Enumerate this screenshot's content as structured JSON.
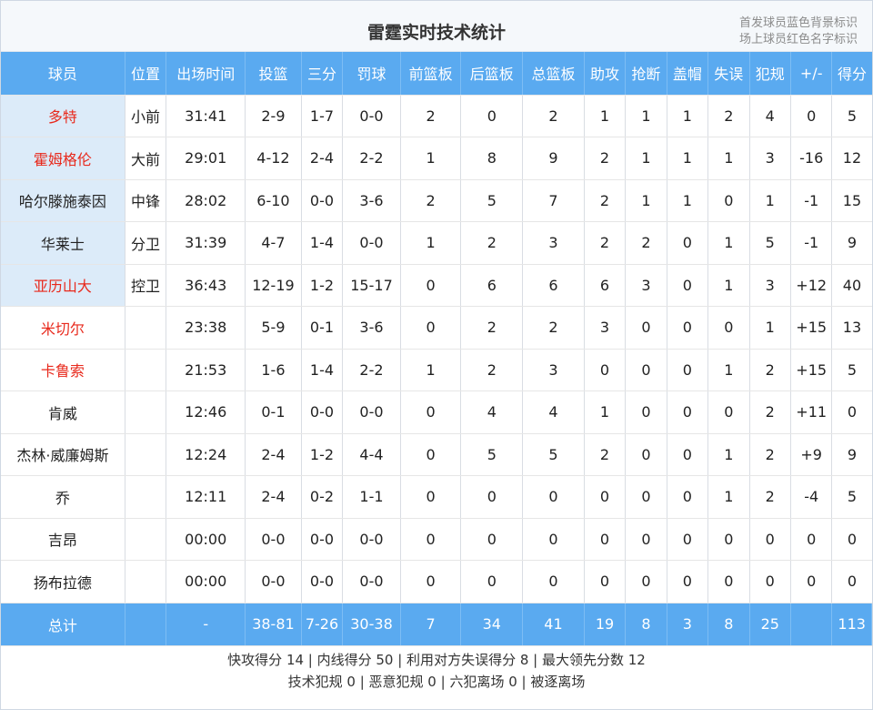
{
  "title": "雷霆实时技术统计",
  "legend": {
    "line1": "首发球员蓝色背景标识",
    "line2": "场上球员红色名字标识"
  },
  "colors": {
    "header_bg": "#5aaaf0",
    "starter_bg": "#dcebf9",
    "on_court_name": "#e8291c"
  },
  "columns": [
    "球员",
    "位置",
    "出场时间",
    "投篮",
    "三分",
    "罚球",
    "前篮板",
    "后篮板",
    "总篮板",
    "助攻",
    "抢断",
    "盖帽",
    "失误",
    "犯规",
    "+/-",
    "得分"
  ],
  "players": [
    {
      "name": "多特",
      "pos": "小前",
      "min": "31:41",
      "fg": "2-9",
      "tp": "1-7",
      "ft": "0-0",
      "oreb": "2",
      "dreb": "0",
      "reb": "2",
      "ast": "1",
      "stl": "1",
      "blk": "1",
      "tov": "2",
      "pf": "4",
      "pm": "0",
      "pts": "5",
      "starter": true,
      "on_court": true
    },
    {
      "name": "霍姆格伦",
      "pos": "大前",
      "min": "29:01",
      "fg": "4-12",
      "tp": "2-4",
      "ft": "2-2",
      "oreb": "1",
      "dreb": "8",
      "reb": "9",
      "ast": "2",
      "stl": "1",
      "blk": "1",
      "tov": "1",
      "pf": "3",
      "pm": "-16",
      "pts": "12",
      "starter": true,
      "on_court": true
    },
    {
      "name": "哈尔滕施泰因",
      "pos": "中锋",
      "min": "28:02",
      "fg": "6-10",
      "tp": "0-0",
      "ft": "3-6",
      "oreb": "2",
      "dreb": "5",
      "reb": "7",
      "ast": "2",
      "stl": "1",
      "blk": "1",
      "tov": "0",
      "pf": "1",
      "pm": "-1",
      "pts": "15",
      "starter": true,
      "on_court": false
    },
    {
      "name": "华莱士",
      "pos": "分卫",
      "min": "31:39",
      "fg": "4-7",
      "tp": "1-4",
      "ft": "0-0",
      "oreb": "1",
      "dreb": "2",
      "reb": "3",
      "ast": "2",
      "stl": "2",
      "blk": "0",
      "tov": "1",
      "pf": "5",
      "pm": "-1",
      "pts": "9",
      "starter": true,
      "on_court": false
    },
    {
      "name": "亚历山大",
      "pos": "控卫",
      "min": "36:43",
      "fg": "12-19",
      "tp": "1-2",
      "ft": "15-17",
      "oreb": "0",
      "dreb": "6",
      "reb": "6",
      "ast": "6",
      "stl": "3",
      "blk": "0",
      "tov": "1",
      "pf": "3",
      "pm": "+12",
      "pts": "40",
      "starter": true,
      "on_court": true
    },
    {
      "name": "米切尔",
      "pos": "",
      "min": "23:38",
      "fg": "5-9",
      "tp": "0-1",
      "ft": "3-6",
      "oreb": "0",
      "dreb": "2",
      "reb": "2",
      "ast": "3",
      "stl": "0",
      "blk": "0",
      "tov": "0",
      "pf": "1",
      "pm": "+15",
      "pts": "13",
      "starter": false,
      "on_court": true
    },
    {
      "name": "卡鲁索",
      "pos": "",
      "min": "21:53",
      "fg": "1-6",
      "tp": "1-4",
      "ft": "2-2",
      "oreb": "1",
      "dreb": "2",
      "reb": "3",
      "ast": "0",
      "stl": "0",
      "blk": "0",
      "tov": "1",
      "pf": "2",
      "pm": "+15",
      "pts": "5",
      "starter": false,
      "on_court": true
    },
    {
      "name": "肯威",
      "pos": "",
      "min": "12:46",
      "fg": "0-1",
      "tp": "0-0",
      "ft": "0-0",
      "oreb": "0",
      "dreb": "4",
      "reb": "4",
      "ast": "1",
      "stl": "0",
      "blk": "0",
      "tov": "0",
      "pf": "2",
      "pm": "+11",
      "pts": "0",
      "starter": false,
      "on_court": false
    },
    {
      "name": "杰林·威廉姆斯",
      "pos": "",
      "min": "12:24",
      "fg": "2-4",
      "tp": "1-2",
      "ft": "4-4",
      "oreb": "0",
      "dreb": "5",
      "reb": "5",
      "ast": "2",
      "stl": "0",
      "blk": "0",
      "tov": "1",
      "pf": "2",
      "pm": "+9",
      "pts": "9",
      "starter": false,
      "on_court": false
    },
    {
      "name": "乔",
      "pos": "",
      "min": "12:11",
      "fg": "2-4",
      "tp": "0-2",
      "ft": "1-1",
      "oreb": "0",
      "dreb": "0",
      "reb": "0",
      "ast": "0",
      "stl": "0",
      "blk": "0",
      "tov": "1",
      "pf": "2",
      "pm": "-4",
      "pts": "5",
      "starter": false,
      "on_court": false
    },
    {
      "name": "吉昂",
      "pos": "",
      "min": "00:00",
      "fg": "0-0",
      "tp": "0-0",
      "ft": "0-0",
      "oreb": "0",
      "dreb": "0",
      "reb": "0",
      "ast": "0",
      "stl": "0",
      "blk": "0",
      "tov": "0",
      "pf": "0",
      "pm": "0",
      "pts": "0",
      "starter": false,
      "on_court": false
    },
    {
      "name": "扬布拉德",
      "pos": "",
      "min": "00:00",
      "fg": "0-0",
      "tp": "0-0",
      "ft": "0-0",
      "oreb": "0",
      "dreb": "0",
      "reb": "0",
      "ast": "0",
      "stl": "0",
      "blk": "0",
      "tov": "0",
      "pf": "0",
      "pm": "0",
      "pts": "0",
      "starter": false,
      "on_court": false
    }
  ],
  "totals": {
    "name": "总计",
    "pos": "",
    "min": "-",
    "fg": "38-81",
    "tp": "7-26",
    "ft": "30-38",
    "oreb": "7",
    "dreb": "34",
    "reb": "41",
    "ast": "19",
    "stl": "8",
    "blk": "3",
    "tov": "8",
    "pf": "25",
    "pm": "",
    "pts": "113"
  },
  "footer": {
    "line1": "快攻得分 14 | 内线得分 50 | 利用对方失误得分 8 | 最大领先分数 12",
    "line2": "技术犯规 0 | 恶意犯规 0 | 六犯离场 0 | 被逐离场"
  }
}
